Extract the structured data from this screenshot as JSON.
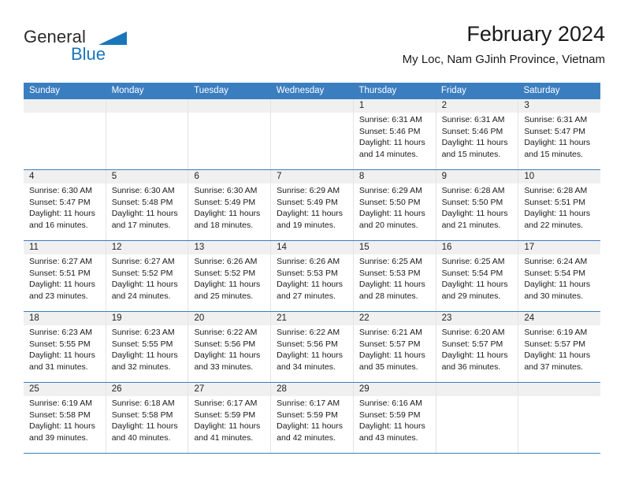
{
  "brand": {
    "name_top": "General",
    "name_bottom": "Blue",
    "color_primary": "#1b75bb",
    "color_text": "#2b2b2b"
  },
  "header": {
    "title": "February 2024",
    "subtitle": "My Loc, Nam GJinh Province, Vietnam"
  },
  "theme": {
    "header_bg": "#3b7ec0",
    "day_strip_bg": "#f0f0f0",
    "grid_line": "#e3e3e3"
  },
  "weekdays": [
    "Sunday",
    "Monday",
    "Tuesday",
    "Wednesday",
    "Thursday",
    "Friday",
    "Saturday"
  ],
  "weeks": [
    [
      {
        "day": "",
        "sunrise": "",
        "sunset": "",
        "daylight_line1": "",
        "daylight_line2": ""
      },
      {
        "day": "",
        "sunrise": "",
        "sunset": "",
        "daylight_line1": "",
        "daylight_line2": ""
      },
      {
        "day": "",
        "sunrise": "",
        "sunset": "",
        "daylight_line1": "",
        "daylight_line2": ""
      },
      {
        "day": "",
        "sunrise": "",
        "sunset": "",
        "daylight_line1": "",
        "daylight_line2": ""
      },
      {
        "day": "1",
        "sunrise": "Sunrise: 6:31 AM",
        "sunset": "Sunset: 5:46 PM",
        "daylight_line1": "Daylight: 11 hours",
        "daylight_line2": "and 14 minutes."
      },
      {
        "day": "2",
        "sunrise": "Sunrise: 6:31 AM",
        "sunset": "Sunset: 5:46 PM",
        "daylight_line1": "Daylight: 11 hours",
        "daylight_line2": "and 15 minutes."
      },
      {
        "day": "3",
        "sunrise": "Sunrise: 6:31 AM",
        "sunset": "Sunset: 5:47 PM",
        "daylight_line1": "Daylight: 11 hours",
        "daylight_line2": "and 15 minutes."
      }
    ],
    [
      {
        "day": "4",
        "sunrise": "Sunrise: 6:30 AM",
        "sunset": "Sunset: 5:47 PM",
        "daylight_line1": "Daylight: 11 hours",
        "daylight_line2": "and 16 minutes."
      },
      {
        "day": "5",
        "sunrise": "Sunrise: 6:30 AM",
        "sunset": "Sunset: 5:48 PM",
        "daylight_line1": "Daylight: 11 hours",
        "daylight_line2": "and 17 minutes."
      },
      {
        "day": "6",
        "sunrise": "Sunrise: 6:30 AM",
        "sunset": "Sunset: 5:49 PM",
        "daylight_line1": "Daylight: 11 hours",
        "daylight_line2": "and 18 minutes."
      },
      {
        "day": "7",
        "sunrise": "Sunrise: 6:29 AM",
        "sunset": "Sunset: 5:49 PM",
        "daylight_line1": "Daylight: 11 hours",
        "daylight_line2": "and 19 minutes."
      },
      {
        "day": "8",
        "sunrise": "Sunrise: 6:29 AM",
        "sunset": "Sunset: 5:50 PM",
        "daylight_line1": "Daylight: 11 hours",
        "daylight_line2": "and 20 minutes."
      },
      {
        "day": "9",
        "sunrise": "Sunrise: 6:28 AM",
        "sunset": "Sunset: 5:50 PM",
        "daylight_line1": "Daylight: 11 hours",
        "daylight_line2": "and 21 minutes."
      },
      {
        "day": "10",
        "sunrise": "Sunrise: 6:28 AM",
        "sunset": "Sunset: 5:51 PM",
        "daylight_line1": "Daylight: 11 hours",
        "daylight_line2": "and 22 minutes."
      }
    ],
    [
      {
        "day": "11",
        "sunrise": "Sunrise: 6:27 AM",
        "sunset": "Sunset: 5:51 PM",
        "daylight_line1": "Daylight: 11 hours",
        "daylight_line2": "and 23 minutes."
      },
      {
        "day": "12",
        "sunrise": "Sunrise: 6:27 AM",
        "sunset": "Sunset: 5:52 PM",
        "daylight_line1": "Daylight: 11 hours",
        "daylight_line2": "and 24 minutes."
      },
      {
        "day": "13",
        "sunrise": "Sunrise: 6:26 AM",
        "sunset": "Sunset: 5:52 PM",
        "daylight_line1": "Daylight: 11 hours",
        "daylight_line2": "and 25 minutes."
      },
      {
        "day": "14",
        "sunrise": "Sunrise: 6:26 AM",
        "sunset": "Sunset: 5:53 PM",
        "daylight_line1": "Daylight: 11 hours",
        "daylight_line2": "and 27 minutes."
      },
      {
        "day": "15",
        "sunrise": "Sunrise: 6:25 AM",
        "sunset": "Sunset: 5:53 PM",
        "daylight_line1": "Daylight: 11 hours",
        "daylight_line2": "and 28 minutes."
      },
      {
        "day": "16",
        "sunrise": "Sunrise: 6:25 AM",
        "sunset": "Sunset: 5:54 PM",
        "daylight_line1": "Daylight: 11 hours",
        "daylight_line2": "and 29 minutes."
      },
      {
        "day": "17",
        "sunrise": "Sunrise: 6:24 AM",
        "sunset": "Sunset: 5:54 PM",
        "daylight_line1": "Daylight: 11 hours",
        "daylight_line2": "and 30 minutes."
      }
    ],
    [
      {
        "day": "18",
        "sunrise": "Sunrise: 6:23 AM",
        "sunset": "Sunset: 5:55 PM",
        "daylight_line1": "Daylight: 11 hours",
        "daylight_line2": "and 31 minutes."
      },
      {
        "day": "19",
        "sunrise": "Sunrise: 6:23 AM",
        "sunset": "Sunset: 5:55 PM",
        "daylight_line1": "Daylight: 11 hours",
        "daylight_line2": "and 32 minutes."
      },
      {
        "day": "20",
        "sunrise": "Sunrise: 6:22 AM",
        "sunset": "Sunset: 5:56 PM",
        "daylight_line1": "Daylight: 11 hours",
        "daylight_line2": "and 33 minutes."
      },
      {
        "day": "21",
        "sunrise": "Sunrise: 6:22 AM",
        "sunset": "Sunset: 5:56 PM",
        "daylight_line1": "Daylight: 11 hours",
        "daylight_line2": "and 34 minutes."
      },
      {
        "day": "22",
        "sunrise": "Sunrise: 6:21 AM",
        "sunset": "Sunset: 5:57 PM",
        "daylight_line1": "Daylight: 11 hours",
        "daylight_line2": "and 35 minutes."
      },
      {
        "day": "23",
        "sunrise": "Sunrise: 6:20 AM",
        "sunset": "Sunset: 5:57 PM",
        "daylight_line1": "Daylight: 11 hours",
        "daylight_line2": "and 36 minutes."
      },
      {
        "day": "24",
        "sunrise": "Sunrise: 6:19 AM",
        "sunset": "Sunset: 5:57 PM",
        "daylight_line1": "Daylight: 11 hours",
        "daylight_line2": "and 37 minutes."
      }
    ],
    [
      {
        "day": "25",
        "sunrise": "Sunrise: 6:19 AM",
        "sunset": "Sunset: 5:58 PM",
        "daylight_line1": "Daylight: 11 hours",
        "daylight_line2": "and 39 minutes."
      },
      {
        "day": "26",
        "sunrise": "Sunrise: 6:18 AM",
        "sunset": "Sunset: 5:58 PM",
        "daylight_line1": "Daylight: 11 hours",
        "daylight_line2": "and 40 minutes."
      },
      {
        "day": "27",
        "sunrise": "Sunrise: 6:17 AM",
        "sunset": "Sunset: 5:59 PM",
        "daylight_line1": "Daylight: 11 hours",
        "daylight_line2": "and 41 minutes."
      },
      {
        "day": "28",
        "sunrise": "Sunrise: 6:17 AM",
        "sunset": "Sunset: 5:59 PM",
        "daylight_line1": "Daylight: 11 hours",
        "daylight_line2": "and 42 minutes."
      },
      {
        "day": "29",
        "sunrise": "Sunrise: 6:16 AM",
        "sunset": "Sunset: 5:59 PM",
        "daylight_line1": "Daylight: 11 hours",
        "daylight_line2": "and 43 minutes."
      },
      {
        "day": "",
        "sunrise": "",
        "sunset": "",
        "daylight_line1": "",
        "daylight_line2": ""
      },
      {
        "day": "",
        "sunrise": "",
        "sunset": "",
        "daylight_line1": "",
        "daylight_line2": ""
      }
    ]
  ]
}
